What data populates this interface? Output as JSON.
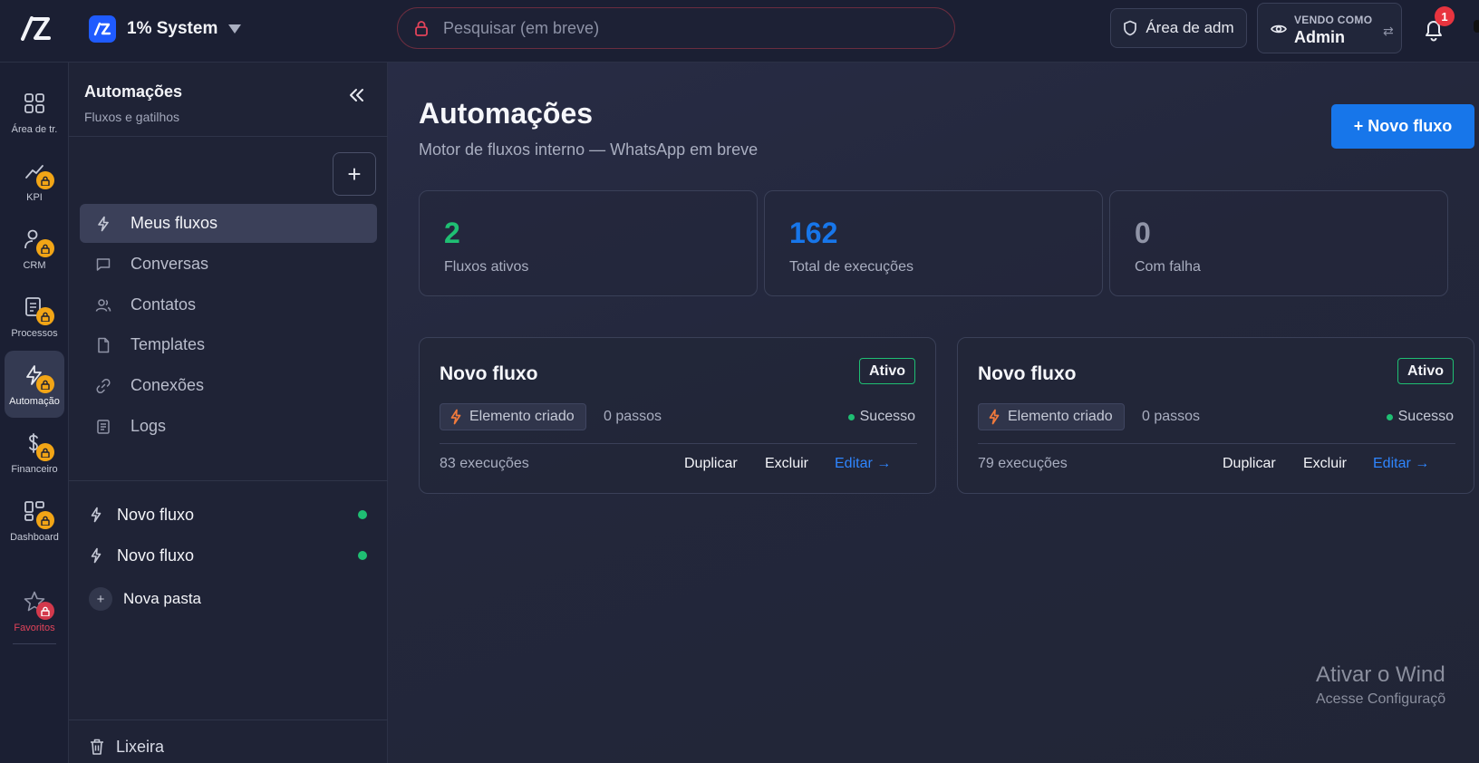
{
  "app": {
    "workspace_name": "1% System"
  },
  "search": {
    "placeholder": "Pesquisar (em breve)"
  },
  "topbar": {
    "admin_area_label": "Área de adm",
    "viewing_as_label": "VENDO COMO",
    "viewing_as_value": "Admin",
    "notifications_count": "1"
  },
  "rail": {
    "items": [
      {
        "label": "Área de tr.",
        "icon": "grid-icon",
        "locked": false
      },
      {
        "label": "KPI",
        "icon": "kpi-icon",
        "locked": true
      },
      {
        "label": "CRM",
        "icon": "person-icon",
        "locked": true
      },
      {
        "label": "Processos",
        "icon": "document-icon",
        "locked": true
      },
      {
        "label": "Automação",
        "icon": "bolt-icon",
        "locked": true,
        "active": true
      },
      {
        "label": "Financeiro",
        "icon": "money-icon",
        "locked": true
      },
      {
        "label": "Dashboard",
        "icon": "dashboard-icon",
        "locked": true
      },
      {
        "label": "Favoritos",
        "icon": "star-icon",
        "locked": true
      }
    ]
  },
  "sidebar": {
    "title": "Automações",
    "subtitle": "Fluxos e gatilhos",
    "add_label": "+",
    "nav": [
      {
        "label": "Meus fluxos",
        "icon": "bolt-icon",
        "active": true
      },
      {
        "label": "Conversas",
        "icon": "chat-icon"
      },
      {
        "label": "Contatos",
        "icon": "users-icon"
      },
      {
        "label": "Templates",
        "icon": "file-icon"
      },
      {
        "label": "Conexões",
        "icon": "link-icon"
      },
      {
        "label": "Logs",
        "icon": "log-icon"
      }
    ],
    "flows": [
      {
        "label": "Novo fluxo",
        "active": true
      },
      {
        "label": "Novo fluxo",
        "active": true
      }
    ],
    "new_folder_label": "Nova pasta",
    "trash_label": "Lixeira"
  },
  "main": {
    "title": "Automações",
    "subtitle": "Motor de fluxos interno — WhatsApp em breve",
    "new_flow_label": "+ Novo fluxo",
    "stats": [
      {
        "value": "2",
        "label": "Fluxos ativos",
        "color": "#1fbf73"
      },
      {
        "value": "162",
        "label": "Total de execuções",
        "color": "#1776ea"
      },
      {
        "value": "0",
        "label": "Com falha",
        "color": "#9094a7"
      }
    ],
    "flow_cards": [
      {
        "name": "Novo fluxo",
        "status": "Ativo",
        "trigger": "Elemento criado",
        "steps": "0 passos",
        "last_result": "Sucesso",
        "executions": "83 execuções",
        "duplicate_label": "Duplicar",
        "delete_label": "Excluir",
        "edit_label": "Editar →"
      },
      {
        "name": "Novo fluxo",
        "status": "Ativo",
        "trigger": "Elemento criado",
        "steps": "0 passos",
        "last_result": "Sucesso",
        "executions": "79 execuções",
        "duplicate_label": "Duplicar",
        "delete_label": "Excluir",
        "edit_label": "Editar →"
      }
    ]
  },
  "watermark": {
    "line1": "Ativar o Wind",
    "line2": "Acesse Configuraçõ"
  },
  "colors": {
    "accent": "#1776ea",
    "success": "#1fbf73",
    "lock": "#f2a516",
    "danger": "#e8343f"
  }
}
